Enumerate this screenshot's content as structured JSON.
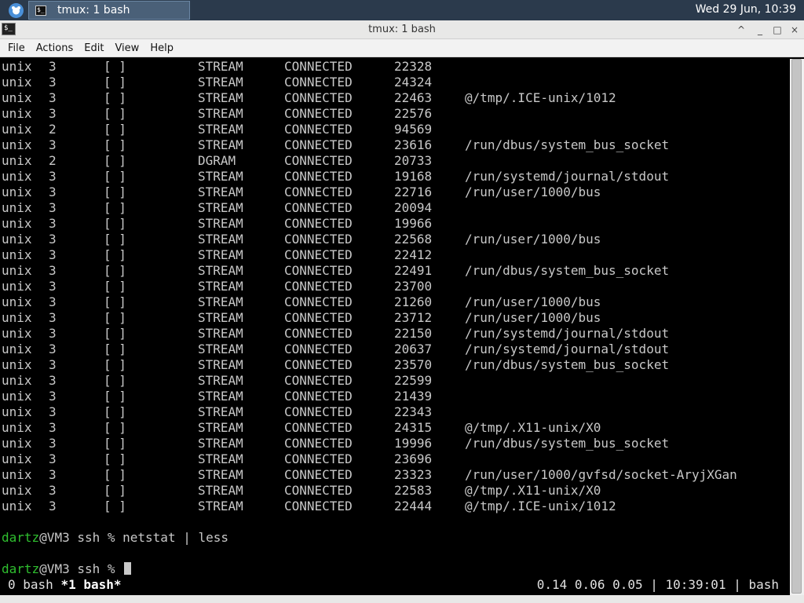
{
  "panel": {
    "menu_icon": "xfce-mouse-icon",
    "task_label": "tmux: 1 bash",
    "task_icon": "terminal-icon",
    "clock": "Wed 29 Jun, 10:39"
  },
  "window": {
    "title": "tmux: 1 bash",
    "buttons": {
      "up": "^",
      "minimize": "_",
      "maximize": "□",
      "close": "×"
    }
  },
  "menubar": [
    "File",
    "Actions",
    "Edit",
    "View",
    "Help"
  ],
  "terminal": {
    "rows": [
      [
        "unix",
        "3",
        "[ ]",
        "STREAM",
        "CONNECTED",
        "22328",
        ""
      ],
      [
        "unix",
        "3",
        "[ ]",
        "STREAM",
        "CONNECTED",
        "24324",
        ""
      ],
      [
        "unix",
        "3",
        "[ ]",
        "STREAM",
        "CONNECTED",
        "22463",
        "@/tmp/.ICE-unix/1012"
      ],
      [
        "unix",
        "3",
        "[ ]",
        "STREAM",
        "CONNECTED",
        "22576",
        ""
      ],
      [
        "unix",
        "2",
        "[ ]",
        "STREAM",
        "CONNECTED",
        "94569",
        ""
      ],
      [
        "unix",
        "3",
        "[ ]",
        "STREAM",
        "CONNECTED",
        "23616",
        "/run/dbus/system_bus_socket"
      ],
      [
        "unix",
        "2",
        "[ ]",
        "DGRAM",
        "CONNECTED",
        "20733",
        ""
      ],
      [
        "unix",
        "3",
        "[ ]",
        "STREAM",
        "CONNECTED",
        "19168",
        "/run/systemd/journal/stdout"
      ],
      [
        "unix",
        "3",
        "[ ]",
        "STREAM",
        "CONNECTED",
        "22716",
        "/run/user/1000/bus"
      ],
      [
        "unix",
        "3",
        "[ ]",
        "STREAM",
        "CONNECTED",
        "20094",
        ""
      ],
      [
        "unix",
        "3",
        "[ ]",
        "STREAM",
        "CONNECTED",
        "19966",
        ""
      ],
      [
        "unix",
        "3",
        "[ ]",
        "STREAM",
        "CONNECTED",
        "22568",
        "/run/user/1000/bus"
      ],
      [
        "unix",
        "3",
        "[ ]",
        "STREAM",
        "CONNECTED",
        "22412",
        ""
      ],
      [
        "unix",
        "3",
        "[ ]",
        "STREAM",
        "CONNECTED",
        "22491",
        "/run/dbus/system_bus_socket"
      ],
      [
        "unix",
        "3",
        "[ ]",
        "STREAM",
        "CONNECTED",
        "23700",
        ""
      ],
      [
        "unix",
        "3",
        "[ ]",
        "STREAM",
        "CONNECTED",
        "21260",
        "/run/user/1000/bus"
      ],
      [
        "unix",
        "3",
        "[ ]",
        "STREAM",
        "CONNECTED",
        "23712",
        "/run/user/1000/bus"
      ],
      [
        "unix",
        "3",
        "[ ]",
        "STREAM",
        "CONNECTED",
        "22150",
        "/run/systemd/journal/stdout"
      ],
      [
        "unix",
        "3",
        "[ ]",
        "STREAM",
        "CONNECTED",
        "20637",
        "/run/systemd/journal/stdout"
      ],
      [
        "unix",
        "3",
        "[ ]",
        "STREAM",
        "CONNECTED",
        "23570",
        "/run/dbus/system_bus_socket"
      ],
      [
        "unix",
        "3",
        "[ ]",
        "STREAM",
        "CONNECTED",
        "22599",
        ""
      ],
      [
        "unix",
        "3",
        "[ ]",
        "STREAM",
        "CONNECTED",
        "21439",
        ""
      ],
      [
        "unix",
        "3",
        "[ ]",
        "STREAM",
        "CONNECTED",
        "22343",
        ""
      ],
      [
        "unix",
        "3",
        "[ ]",
        "STREAM",
        "CONNECTED",
        "24315",
        "@/tmp/.X11-unix/X0"
      ],
      [
        "unix",
        "3",
        "[ ]",
        "STREAM",
        "CONNECTED",
        "19996",
        "/run/dbus/system_bus_socket"
      ],
      [
        "unix",
        "3",
        "[ ]",
        "STREAM",
        "CONNECTED",
        "23696",
        ""
      ],
      [
        "unix",
        "3",
        "[ ]",
        "STREAM",
        "CONNECTED",
        "23323",
        "/run/user/1000/gvfsd/socket-AryjXGan"
      ],
      [
        "unix",
        "3",
        "[ ]",
        "STREAM",
        "CONNECTED",
        "22583",
        "@/tmp/.X11-unix/X0"
      ],
      [
        "unix",
        "3",
        "[ ]",
        "STREAM",
        "CONNECTED",
        "22444",
        "@/tmp/.ICE-unix/1012"
      ]
    ],
    "prompts": [
      {
        "user": "dartz",
        "rest": "@VM3 ssh % ",
        "command": "netstat | less"
      },
      {
        "user": "dartz",
        "rest": "@VM3 ssh % ",
        "command": ""
      }
    ],
    "status": {
      "windows_inactive": "0 bash",
      "windows_active": "*1 bash*",
      "right": "0.14 0.06 0.05 | 10:39:01 | bash"
    },
    "prompt_color": "#2fbf2f"
  }
}
